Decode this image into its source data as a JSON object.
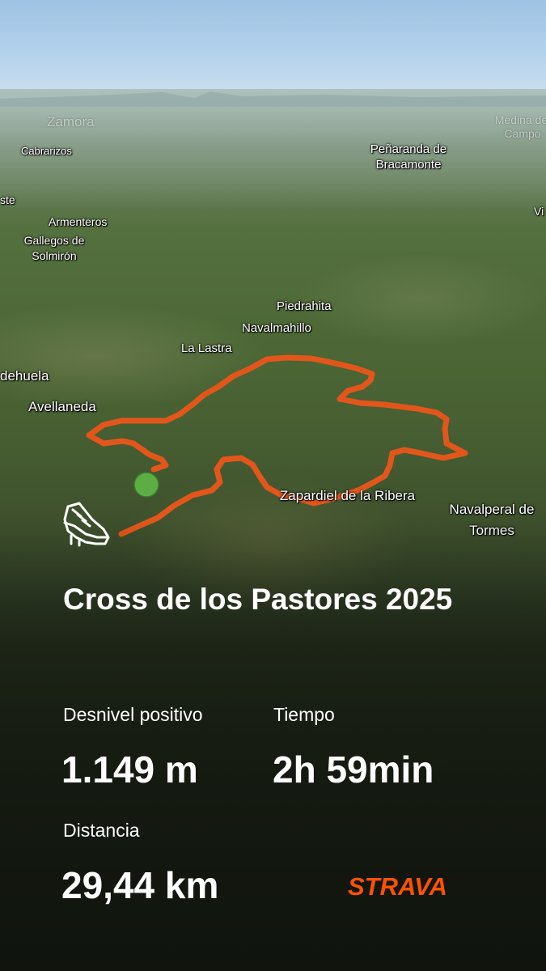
{
  "map": {
    "places": [
      "Zamora",
      "Medina del Campo",
      "Cabrarizos",
      "Peñaranda de Bracamonte",
      "ste",
      "Vi",
      "Armenteros",
      "Gallegos de Solmirón",
      "Piedrahita",
      "Navalmahillo",
      "La Lastra",
      "dehuela",
      "Avellaneda",
      "Zapardiel de la Ribera",
      "Navalperal de Tormes"
    ],
    "route_color": "#e2561c",
    "start_marker_color": "#5cae44"
  },
  "activity": {
    "icon": "running-shoe-icon",
    "title": "Cross de los Pastores 2025"
  },
  "stats": {
    "elevation_label": "Desnivel positivo",
    "elevation_value": "1.149 m",
    "time_label": "Tiempo",
    "time_value": "2h 59min",
    "distance_label": "Distancia",
    "distance_value": "29,44 km"
  },
  "brand": {
    "name": "STRAVA",
    "color": "#fc5200"
  }
}
